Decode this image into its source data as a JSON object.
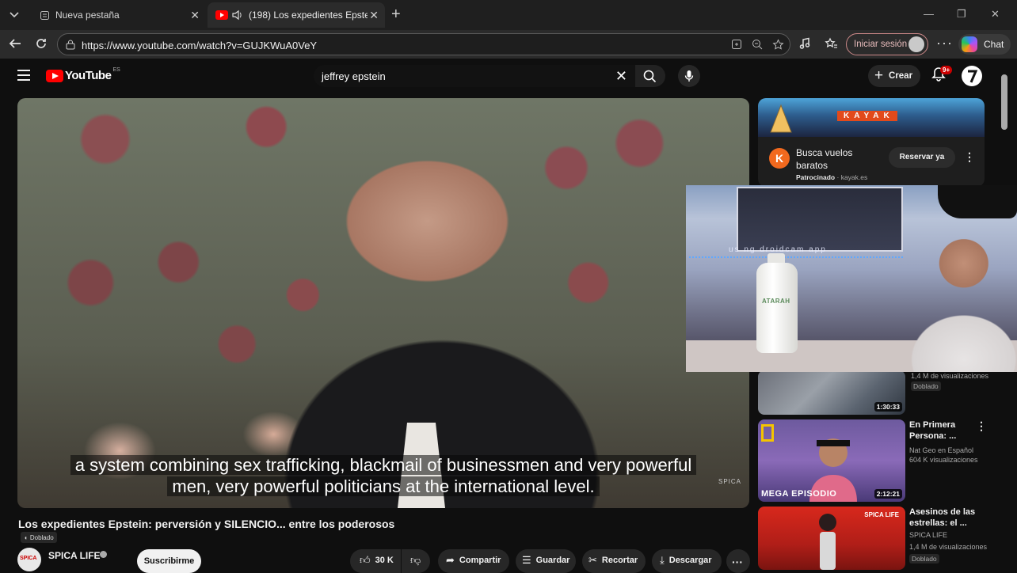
{
  "browser": {
    "tabs": [
      {
        "title": "Nueva pestaña",
        "active": false
      },
      {
        "title": "(198) Los expedientes Epstein",
        "active": true
      }
    ],
    "url": "https://www.youtube.com/watch?v=GUJKWuA0VeY",
    "signin_label": "Iniciar sesión",
    "chat_label": "Chat"
  },
  "youtube": {
    "logo_text": "YouTube",
    "country_code": "ES",
    "search_query": "jeffrey epstein",
    "create_label": "Crear",
    "notifications_badge": "9+"
  },
  "video": {
    "captions_line1": "a system combining sex trafficking, blackmail of businessmen and very powerful",
    "captions_line2": "men, very powerful politicians at the international level.",
    "watermark": "SPICA",
    "title": "Los expedientes Epstein: perversión y SILENCIO... entre los poderosos",
    "dubbed_label": "Doblado",
    "channel_name": "SPICA LIFE",
    "channel_avatar_text": "SPICA",
    "subscribe_label": "Suscribirme",
    "likes": "30 K",
    "share_label": "Compartir",
    "save_label": "Guardar",
    "clip_label": "Recortar",
    "download_label": "Descargar"
  },
  "sidebar": {
    "ad": {
      "banner_brand": "KAYAK",
      "logo_letter": "K",
      "title": "Busca vuelos baratos",
      "sponsored": "Patrocinado",
      "domain": "kayak.es",
      "cta": "Reservar ya"
    },
    "recommendations": [
      {
        "title": "",
        "channel": "",
        "views": "1,4 M de visualizaciones",
        "dubbed": "Doblado",
        "duration": "1:30:33"
      },
      {
        "title": "En Primera Persona: ...",
        "channel": "Nat Geo en Español",
        "views": "604 K visualizaciones",
        "dubbed": "",
        "duration": "2:12:21",
        "thumb_text": "MEGA EPISODIO"
      },
      {
        "title": "Asesinos de las estrellas: el ...",
        "channel": "SPICA LIFE",
        "views": "1,4 M de visualizaciones",
        "dubbed": "Doblado",
        "duration": "",
        "thumb_text": "SPICA LIFE"
      }
    ]
  },
  "webcam": {
    "overlay_text": "us ng droidcam app",
    "bottle_label": "ATARAH"
  },
  "colors": {
    "youtube_red": "#ff0000",
    "background": "#0f0f0f",
    "kayak_orange": "#f2691e"
  }
}
